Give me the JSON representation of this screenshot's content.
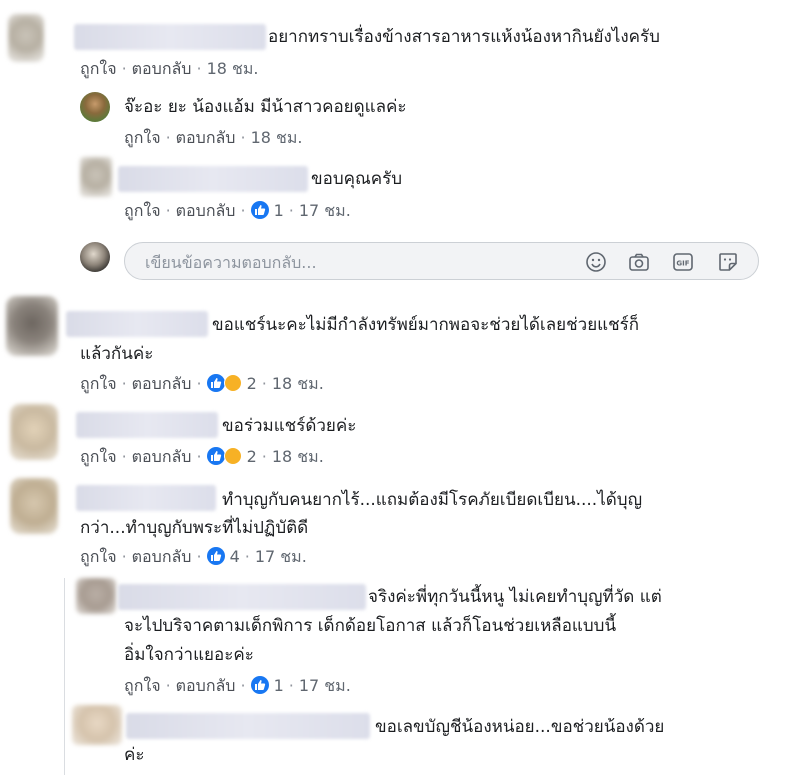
{
  "actions": {
    "like": "ถูกใจ",
    "reply": "ตอบกลับ",
    "sep": "·"
  },
  "comments": [
    {
      "text_lines": [
        "อยากทราบเรื่องข้างสารอาหารแห้งน้องหากินยังไงครับ"
      ],
      "time": "18 ชม."
    },
    {
      "text_lines": [
        "จ๊ะอะ ยะ น้องแอ้ม มีน้าสาวคอยดูแลค่ะ"
      ],
      "time": "18 ชม."
    },
    {
      "text_lines": [
        "ขอบคุณครับ"
      ],
      "reactions": "1",
      "time": "17 ชม."
    },
    {
      "text_lines": [
        "ขอแชร์นะคะไม่มีกำลังทรัพย์มากพอจะช่วยได้เลยช่วยแชร์ก็",
        "แล้วกันค่ะ"
      ],
      "reactions": "2",
      "time": "18 ชม."
    },
    {
      "text_lines": [
        "ขอร่วมแชร์ด้วยค่ะ"
      ],
      "reactions": "2",
      "time": "18 ชม."
    },
    {
      "text_lines": [
        "ทำบุญกับคนยากไร้...แถมต้องมีโรคภัยเบียดเบียน....ได้บุญ",
        "กว่า...ทำบุญกับพระที่ไม่ปฏิบัติดี"
      ],
      "reactions": "4",
      "time": "17 ชม."
    },
    {
      "text_lines": [
        "จริงค่ะพี่ทุกวันนี้หนู ไม่เคยทำบุญที่วัด แต่",
        "จะไปบริจาคตามเด็กพิการ เด็กด้อยโอกาส แล้วก็โอนช่วยเหลือแบบนี้",
        "อิ่มใจกว่าแยอะค่ะ"
      ],
      "reactions": "1",
      "time": "17 ชม."
    },
    {
      "text_lines": [
        "ขอเลขบัญชีน้องหน่อย...ขอช่วยน้องด้วย",
        "ค่ะ"
      ]
    }
  ],
  "composer": {
    "placeholder": "เขียนข้อความตอบกลับ...",
    "icons": [
      "smiley-icon",
      "camera-icon",
      "gif-icon",
      "sticker-icon"
    ]
  },
  "colors": {
    "like_blue": "#1877f2",
    "haha_yellow": "#f7b125",
    "meta_grey": "#606770"
  }
}
